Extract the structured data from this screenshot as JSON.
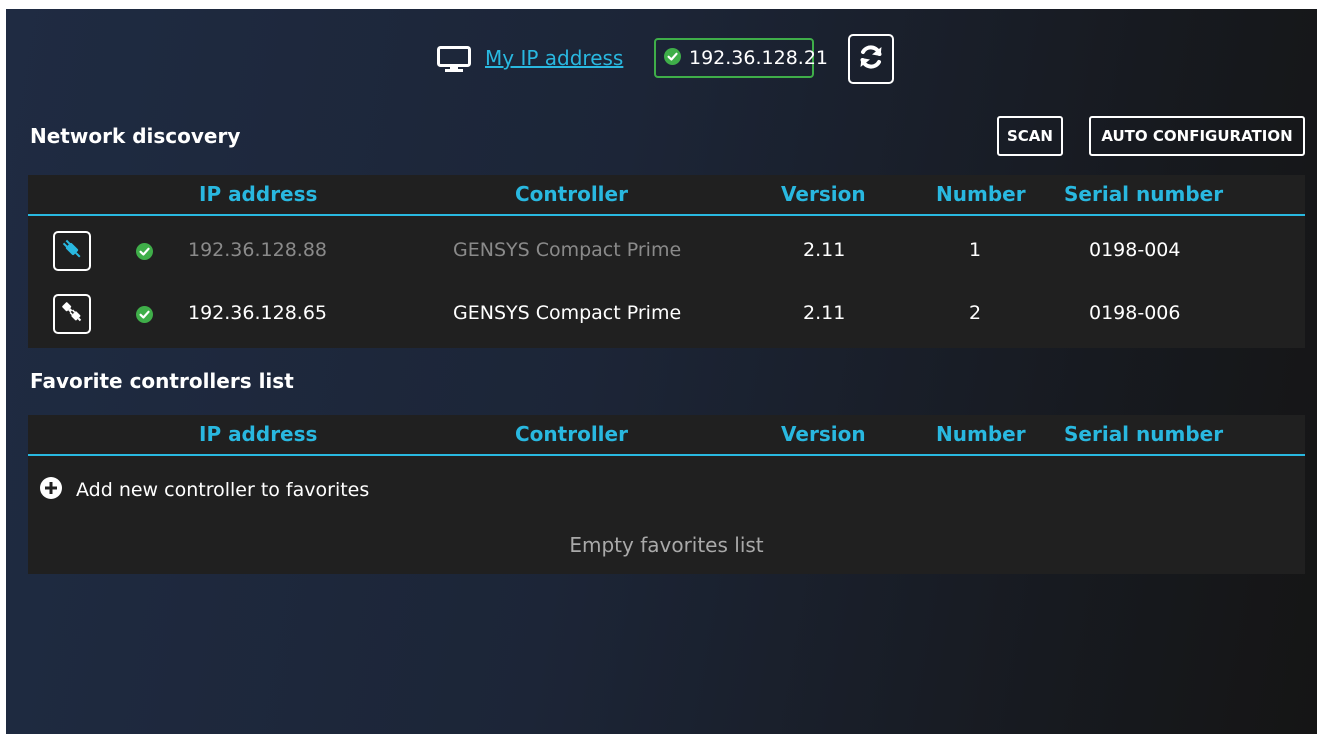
{
  "colors": {
    "accent": "#29b8e0",
    "success": "#3fae49",
    "panel": "#202020",
    "muted_text": "#8a8a8a"
  },
  "topbar": {
    "my_ip_label": "My IP address",
    "ip_value": "192.36.128.21",
    "ip_status": "connected",
    "refresh_icon": "refresh-icon",
    "monitor_icon": "monitor-icon"
  },
  "discovery": {
    "title": "Network discovery",
    "scan_label": "SCAN",
    "auto_config_label": "AUTO CONFIGURATION",
    "columns": [
      "IP address",
      "Controller",
      "Version",
      "Number",
      "Serial number"
    ],
    "rows": [
      {
        "ip": "192.36.128.88",
        "controller": "GENSYS Compact Prime",
        "version": "2.11",
        "number": "1",
        "serial": "0198-004",
        "connected": true,
        "status": "online"
      },
      {
        "ip": "192.36.128.65",
        "controller": "GENSYS Compact Prime",
        "version": "2.11",
        "number": "2",
        "serial": "0198-006",
        "connected": false,
        "status": "online"
      }
    ]
  },
  "favorites": {
    "title": "Favorite controllers list",
    "columns": [
      "IP address",
      "Controller",
      "Version",
      "Number",
      "Serial number"
    ],
    "add_label": "Add new controller to favorites",
    "empty_text": "Empty favorites list"
  }
}
